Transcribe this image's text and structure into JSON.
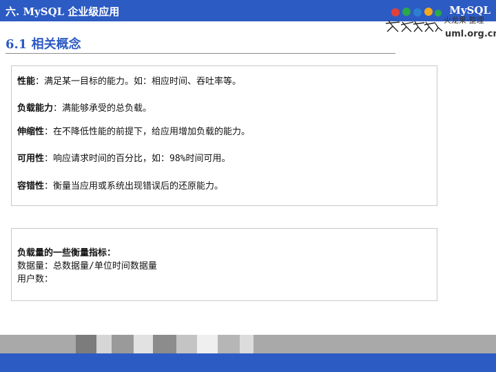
{
  "header": {
    "title": "六. MySQL 企业级应用",
    "brand": "MySQL"
  },
  "logo": {
    "tagline": "火龙果·整理",
    "site": "uml.org.cn"
  },
  "section": {
    "title": "6.1 相关概念"
  },
  "definitions": [
    {
      "term": "性能",
      "sep": "：",
      "text": "满足某一目标的能力。如：相应时间、吞吐率等。"
    },
    {
      "term": "负载能力",
      "sep": "：",
      "text": "满能够承受的总负载。"
    },
    {
      "term": "伸缩性",
      "sep": "：",
      "text": "在不降低性能的前提下，给应用增加负载的能力。"
    },
    {
      "term": "可用性",
      "sep": "：",
      "text": "响应请求时间的百分比，如：98%时间可用。"
    },
    {
      "term": "容错性",
      "sep": "：",
      "text": "衡量当应用或系统出现错误后的还原能力。"
    }
  ],
  "metrics": {
    "heading": "负载量的一些衡量指标：",
    "lines": [
      "数据量：总数据量/单位时间数据量",
      "用户数："
    ]
  },
  "colors": {
    "accent": "#2d5bc4",
    "footer_gray": "#a9a9a9"
  }
}
